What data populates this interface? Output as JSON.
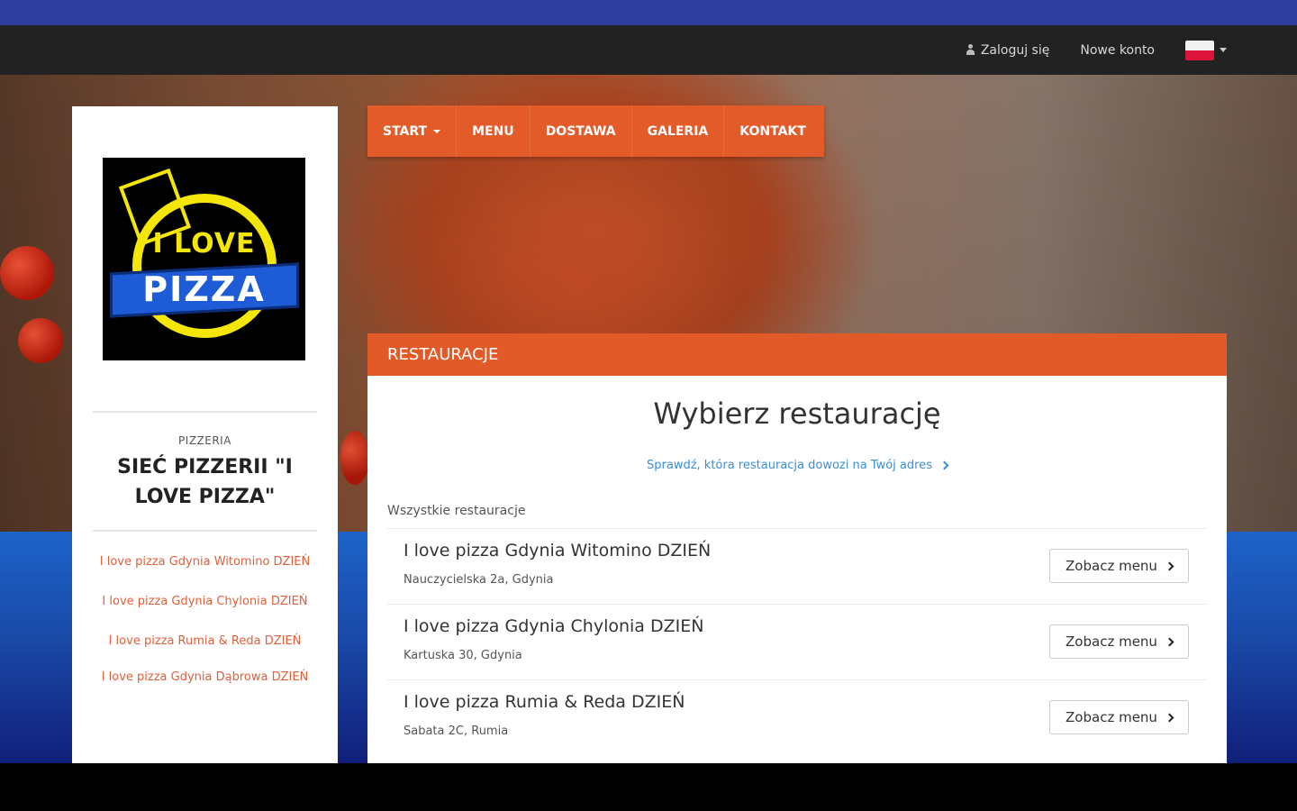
{
  "navbar": {
    "login_label": "Zaloguj się",
    "register_label": "Nowe konto",
    "language_flag": "pl-flag-icon"
  },
  "menu": {
    "items": [
      "START",
      "MENU",
      "DOSTAWA",
      "GALERIA",
      "KONTAKT"
    ]
  },
  "sidebar": {
    "logo_text_top": "I LOVE",
    "logo_text_bottom": "PIZZA",
    "kicker": "PIZZERIA",
    "title": "SIEĆ PIZZERII \"I LOVE PIZZA\"",
    "links": [
      "I love pizza Gdynia Witomino DZIEŃ",
      "I love pizza Gdynia Chylonia DZIEŃ",
      "I love pizza Rumia & Reda DZIEŃ",
      "I love pizza Gdynia Dąbrowa DZIEŃ"
    ]
  },
  "panel": {
    "header": "RESTAURACJE",
    "title": "Wybierz restaurację",
    "check_link": "Sprawdź, która restauracja dowozi na Twój adres",
    "all_label": "Wszystkie restauracje",
    "restaurants": [
      {
        "name": "I love pizza Gdynia Witomino DZIEŃ",
        "address": "Nauczycielska 2a, Gdynia",
        "button": "Zobacz menu"
      },
      {
        "name": "I love pizza Gdynia Chylonia DZIEŃ",
        "address": "Kartuska 30, Gdynia",
        "button": "Zobacz menu"
      },
      {
        "name": "I love pizza Rumia & Reda DZIEŃ",
        "address": "Sabata 2C, Rumia",
        "button": "Zobacz menu"
      }
    ]
  },
  "colors": {
    "accent": "#e35b28",
    "navbar": "#222222",
    "top_strip": "#2f3e9e",
    "link": "#3a8ed4",
    "sidebar_link": "#e0603a"
  }
}
